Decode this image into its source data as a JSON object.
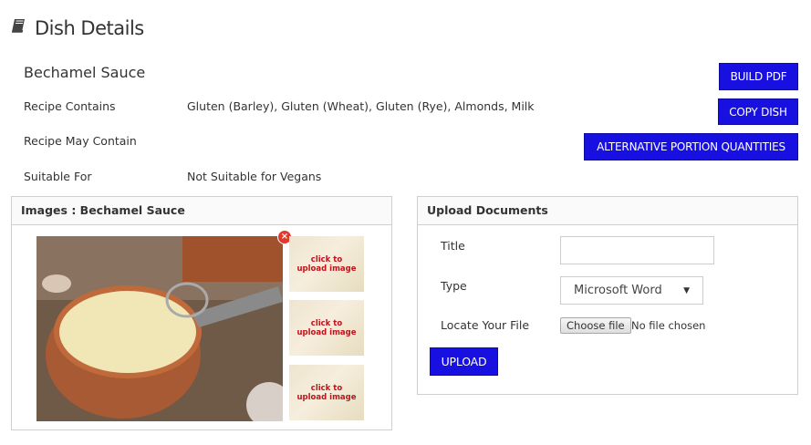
{
  "header": {
    "title": "Dish Details",
    "icon": "book-icon"
  },
  "dish": {
    "name": "Bechamel Sauce",
    "rows": [
      {
        "label": "Recipe Contains",
        "value": "Gluten (Barley), Gluten (Wheat), Gluten (Rye), Almonds, Milk"
      },
      {
        "label": "Recipe May Contain",
        "value": ""
      },
      {
        "label": "Suitable For",
        "value": "Not Suitable for Vegans"
      }
    ]
  },
  "actions": {
    "build_pdf": "BUILD PDF",
    "copy_dish": "COPY DISH",
    "alt_portions": "ALTERNATIVE PORTION QUANTITIES"
  },
  "images_panel": {
    "title": "Images : Bechamel Sauce",
    "remove_glyph": "×",
    "thumbnails": [
      {
        "line1": "click to",
        "line2": "upload image"
      },
      {
        "line1": "click to",
        "line2": "upload image"
      },
      {
        "line1": "click to",
        "line2": "upload image"
      }
    ]
  },
  "upload_panel": {
    "title": "Upload Documents",
    "title_label": "Title",
    "title_value": "",
    "type_label": "Type",
    "type_selected": "Microsoft Word",
    "file_label": "Locate Your File",
    "choose_file": "Choose file",
    "file_status": "No file chosen",
    "upload_button": "UPLOAD"
  },
  "colors": {
    "button": "#1710e0",
    "badge": "#e3382b",
    "thumb_text": "#c0121b"
  }
}
